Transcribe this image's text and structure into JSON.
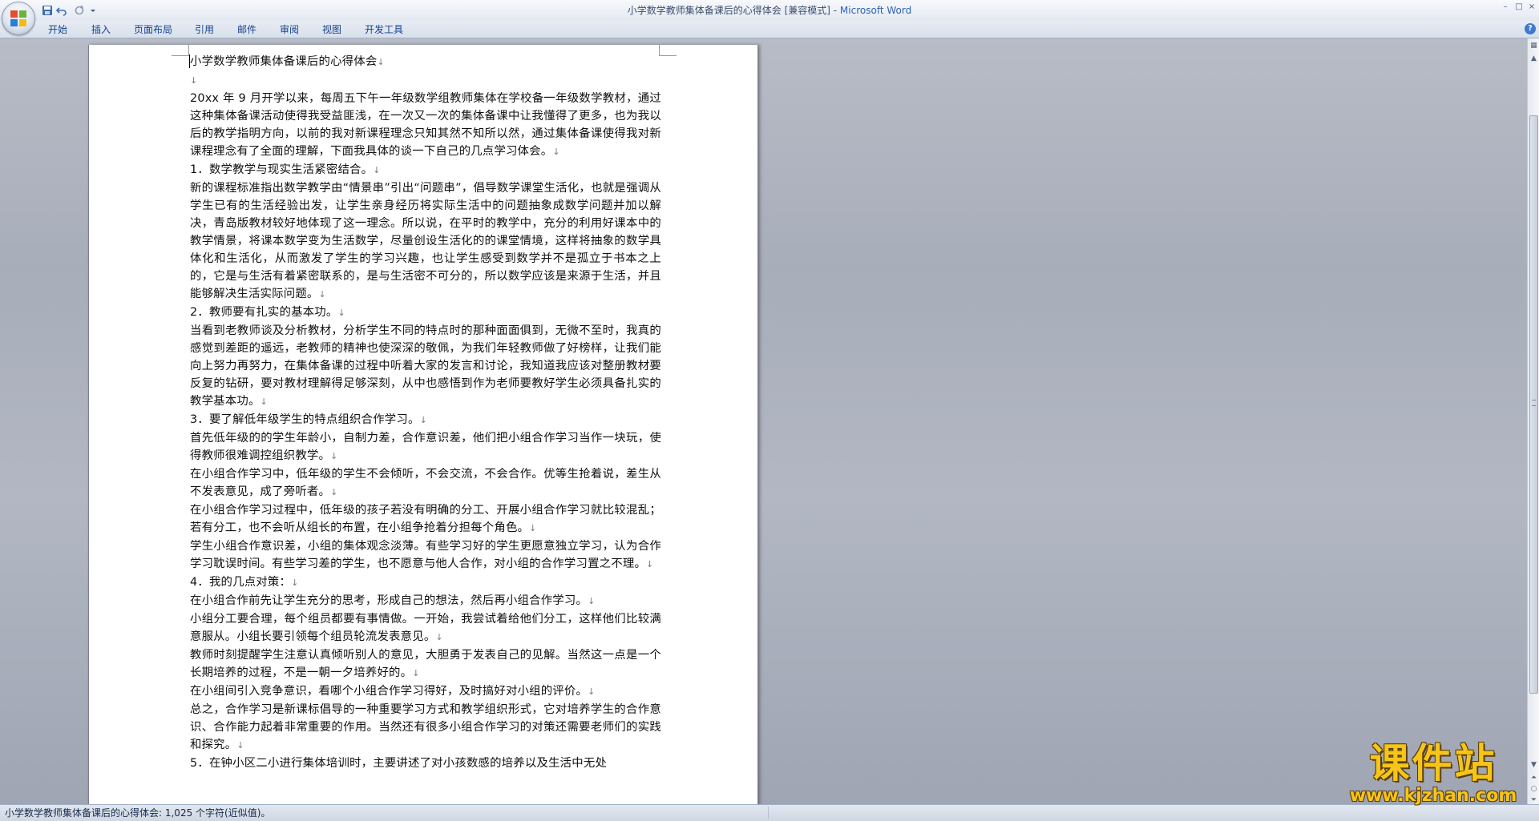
{
  "window": {
    "title_doc": "小学数学教师集体备课后的心得体会 [兼容模式] - ",
    "title_app": "Microsoft Word",
    "controls": {
      "minimize": "–",
      "maximize": "□",
      "close": "×"
    }
  },
  "quick_access": {
    "save_icon": "save-icon",
    "undo_icon": "undo-icon",
    "redo_icon": "redo-icon",
    "customize_icon": "dropdown-icon"
  },
  "ribbon": {
    "tabs": [
      "开始",
      "插入",
      "页面布局",
      "引用",
      "邮件",
      "审阅",
      "视图",
      "开发工具"
    ],
    "help": "?"
  },
  "document": {
    "title": "小学数学教师集体备课后的心得体会",
    "paragraphs": [
      "",
      "20xx 年 9 月开学以来，每周五下午一年级数学组教师集体在学校备一年级数学教材，通过这种集体备课活动使得我受益匪浅，在一次又一次的集体备课中让我懂得了更多，也为我以后的教学指明方向，以前的我对新课程理念只知其然不知所以然，通过集体备课使得我对新课程理念有了全面的理解，下面我具体的谈一下自己的几点学习体会。",
      "1．数学教学与现实生活紧密结合。",
      "新的课程标准指出数学教学由“情景串”引出“问题串”，倡导数学课堂生活化，也就是强调从学生已有的生活经验出发，让学生亲身经历将实际生活中的问题抽象成数学问题并加以解决，青岛版教材较好地体现了这一理念。所以说，在平时的教学中，充分的利用好课本中的教学情景，将课本数学变为生活数学，尽量创设生活化的的课堂情境，这样将抽象的数学具体化和生活化，从而激发了学生的学习兴趣，也让学生感受到数学并不是孤立于书本之上的，它是与生活有着紧密联系的，是与生活密不可分的，所以数学应该是来源于生活，并且能够解决生活实际问题。",
      "2．教师要有扎实的基本功。",
      "当看到老教师谈及分析教材，分析学生不同的特点时的那种面面俱到，无微不至时，我真的感觉到差距的遥远，老教师的精神也使深深的敬佩，为我们年轻教师做了好榜样，让我们能向上努力再努力，在集体备课的过程中听着大家的发言和讨论，我知道我应该对整册教材要反复的钻研，要对教材理解得足够深刻，从中也感悟到作为老师要教好学生必须具备扎实的教学基本功。",
      "3．要了解低年级学生的特点组织合作学习。",
      "首先低年级的的学生年龄小，自制力差，合作意识差，他们把小组合作学习当作一块玩，使得教师很难调控组织教学。",
      "在小组合作学习中，低年级的学生不会倾听，不会交流，不会合作。优等生抢着说，差生从不发表意见，成了旁听者。",
      "在小组合作学习过程中，低年级的孩子若没有明确的分工、开展小组合作学习就比较混乱；若有分工，也不会听从组长的布置，在小组争抢着分担每个角色。",
      "学生小组合作意识差，小组的集体观念淡薄。有些学习好的学生更愿意独立学习，认为合作学习耽误时间。有些学习差的学生，也不愿意与他人合作，对小组的合作学习置之不理。",
      "4．我的几点对策：",
      "在小组合作前先让学生充分的思考，形成自己的想法，然后再小组合作学习。",
      "小组分工要合理，每个组员都要有事情做。一开始，我尝试着给他们分工，这样他们比较满意服从。小组长要引领每个组员轮流发表意见。",
      "教师时刻提醒学生注意认真倾听别人的意见，大胆勇于发表自己的见解。当然这一点是一个长期培养的过程，不是一朝一夕培养好的。",
      "在小组间引入竞争意识，看哪个小组合作学习得好，及时搞好对小组的评价。",
      "总之，合作学习是新课标倡导的一种重要学习方式和教学组织形式，它对培养学生的合作意识、合作能力起着非常重要的作用。当然还有很多小组合作学习的对策还需要老师们的实践和探究。",
      "5．在钟小区二小进行集体培训时，主要讲述了对小孩数感的培养以及生活中无处"
    ]
  },
  "status": {
    "text": "小学数学教师集体备课后的心得体会: 1,025 个字符(近似值)。"
  },
  "watermark": {
    "logo": "课件站",
    "url": "www.kjzhan.com"
  },
  "colors": {
    "accent": "#15428b",
    "page": "#ffffff",
    "workspace": "#abb0bb",
    "watermark": "#f6c51a"
  }
}
